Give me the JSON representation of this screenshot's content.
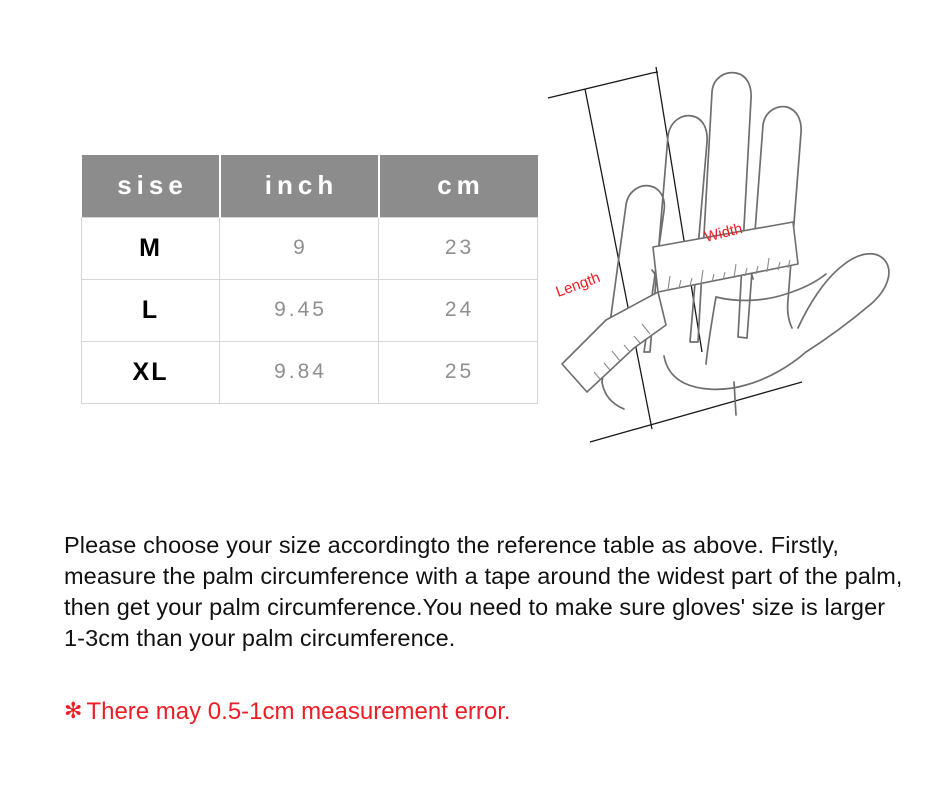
{
  "table": {
    "name": "glove-size-chart",
    "headers": [
      "sise",
      "inch",
      "cm"
    ],
    "rows": [
      {
        "size": "M",
        "inch": "9",
        "cm": "23"
      },
      {
        "size": "L",
        "inch": "9.45",
        "cm": "24"
      },
      {
        "size": "XL",
        "inch": "9.84",
        "cm": "25"
      }
    ]
  },
  "diagram": {
    "name": "hand-measurement-diagram",
    "labels": {
      "width": "Width",
      "length": "Length"
    },
    "colors": {
      "label": "#ee1c24",
      "outline": "#6e6e6e",
      "guide": "#1a1a1a"
    }
  },
  "instructions": {
    "text": "Please choose your size accordingto the reference table as above. Firstly, measure the palm circumference with a tape around the widest part of the palm, then get your palm circumference.You need to make sure gloves' size is larger 1-3cm than your palm circumference."
  },
  "error_note": {
    "star": "✻",
    "text": "There may 0.5-1cm measurement error.",
    "color": "#ee1c24"
  },
  "colors": {
    "header_background": "#8c8c8c",
    "header_text": "#ffffff",
    "cell_border": "#d6d6d6",
    "number_text": "#8f8f8f",
    "accent_red": "#ee1c24",
    "page_background": "#ffffff"
  }
}
